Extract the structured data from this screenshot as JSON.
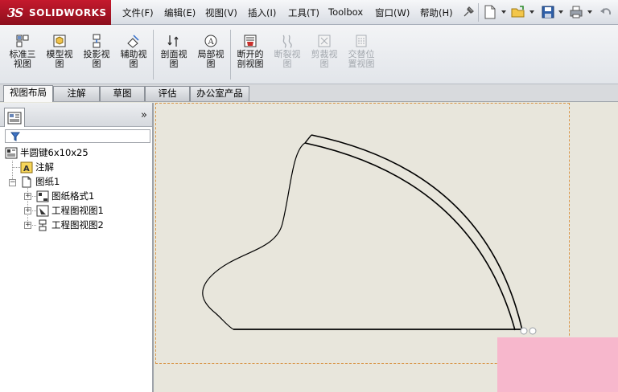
{
  "app": {
    "logo_ds": "3S",
    "logo_word": "SOLIDWORKS"
  },
  "menu": {
    "items": [
      "文件(F)",
      "编辑(E)",
      "视图(V)",
      "插入(I)",
      "工具(T)",
      "Toolbox",
      "窗口(W)",
      "帮助(H)"
    ]
  },
  "ribbon": {
    "buttons": [
      {
        "label1": "标准三",
        "label2": "视图",
        "icon": "standard-3-view-icon",
        "enabled": true
      },
      {
        "label1": "模型视",
        "label2": "图",
        "icon": "model-view-icon",
        "enabled": true
      },
      {
        "label1": "投影视",
        "label2": "图",
        "icon": "projected-view-icon",
        "enabled": true
      },
      {
        "label1": "辅助视",
        "label2": "图",
        "icon": "auxiliary-view-icon",
        "enabled": true
      },
      {
        "label1": "剖面视",
        "label2": "图",
        "icon": "section-view-icon",
        "enabled": true
      },
      {
        "label1": "局部视",
        "label2": "图",
        "icon": "detail-view-icon",
        "enabled": true
      },
      {
        "label1": "断开的",
        "label2": "剖视图",
        "icon": "broken-out-section-icon",
        "enabled": true
      },
      {
        "label1": "断裂视",
        "label2": "图",
        "icon": "break-view-icon",
        "enabled": false
      },
      {
        "label1": "剪裁视",
        "label2": "图",
        "icon": "crop-view-icon",
        "enabled": false
      },
      {
        "label1": "交替位",
        "label2": "置视图",
        "icon": "alternate-position-view-icon",
        "enabled": false
      }
    ]
  },
  "tabs": [
    "视图布局",
    "注解",
    "草图",
    "评估",
    "办公室产品"
  ],
  "active_tab": "视图布局",
  "feature_tree": {
    "expand_glyph": "»",
    "root": "半圆键6x10x25",
    "items": [
      {
        "label": "注解",
        "icon": "annotations-icon",
        "level": 1
      },
      {
        "label": "图纸1",
        "icon": "sheet-icon",
        "level": 1
      },
      {
        "label": "图纸格式1",
        "icon": "sheet-format-icon",
        "level": 2
      },
      {
        "label": "工程图视图1",
        "icon": "drawing-view-icon",
        "level": 2
      },
      {
        "label": "工程图视图2",
        "icon": "drawing-view-icon",
        "level": 2
      }
    ]
  },
  "colors": {
    "logo_red": "#b3162a",
    "sheet_border": "#d9964a",
    "canvas_bg": "#e8e6dc",
    "overlay_pink": "#f7b7cc"
  }
}
